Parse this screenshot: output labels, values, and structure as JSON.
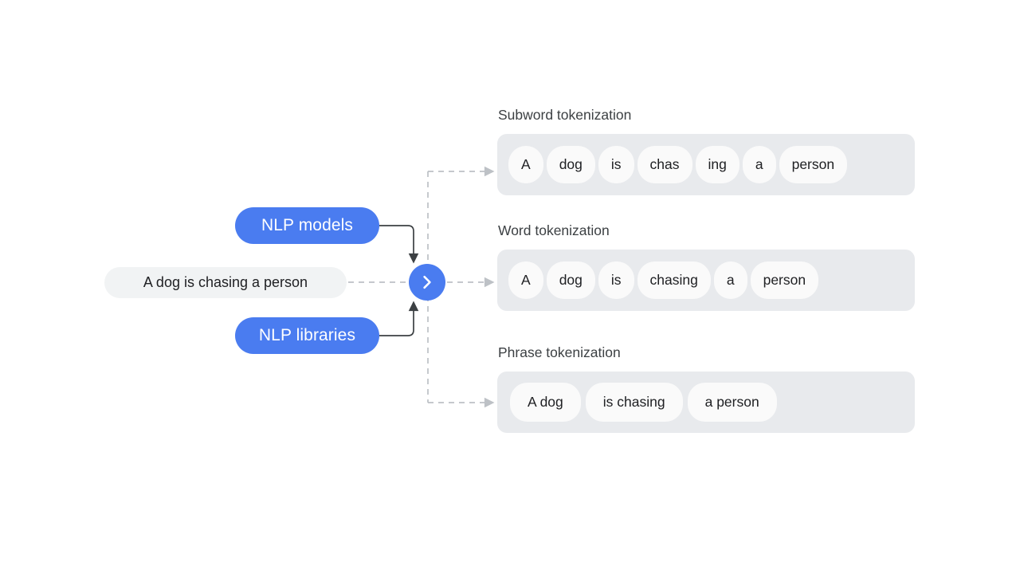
{
  "colors": {
    "accent_blue": "#4a7cf0",
    "row_background": "#e8eaed",
    "chip_background": "#fafafa",
    "input_pill_background": "#f1f3f4",
    "label_text": "#3c4043",
    "connector_solid": "#3c4043",
    "connector_dashed": "#bdc1c6"
  },
  "source": {
    "input_sentence": "A dog is chasing a person",
    "methods": [
      {
        "label": "NLP models"
      },
      {
        "label": "NLP libraries"
      }
    ],
    "node_icon": "chevron-right-icon"
  },
  "outputs": [
    {
      "id": "subword",
      "label": "Subword tokenization",
      "tokens": [
        "A",
        "dog",
        "is",
        "chas",
        "ing",
        "a",
        "person"
      ]
    },
    {
      "id": "word",
      "label": "Word tokenization",
      "tokens": [
        "A",
        "dog",
        "is",
        "chasing",
        "a",
        "person"
      ]
    },
    {
      "id": "phrase",
      "label": "Phrase tokenization",
      "tokens": [
        "A dog",
        "is chasing",
        "a person"
      ]
    }
  ]
}
